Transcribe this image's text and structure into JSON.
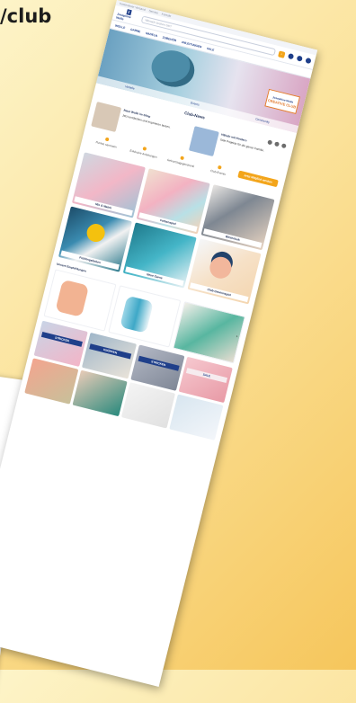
{
  "url_fragment": "/club",
  "page": {
    "topbar": [
      "Kostenloser Versand",
      "Service",
      "Kontakt"
    ],
    "logo": {
      "mark": "J",
      "name": "Josephine Wolle"
    },
    "search_placeholder": "Wonach suchen Sie?",
    "nav": [
      "WOLLE",
      "GARNE",
      "NADELN",
      "ZUBEHÖR",
      "ANLEITUNGEN",
      "SALE"
    ],
    "hero": {
      "badge_line1": "Josephine Wolle",
      "badge_line2": "CREATIVE CLUB",
      "tabs": [
        "Vorteile",
        "Events",
        "Community"
      ]
    },
    "section_title": "Club-News",
    "news": [
      {
        "title": "Neue Wolle im Shop",
        "text": "Jetzt entdecken und inspirieren lassen."
      },
      {
        "title": "Häkeln mit Kindern",
        "text": "Tolle Projekte für die ganze Familie."
      }
    ],
    "benefits": [
      "Punkte sammeln",
      "Exklusive Anleitungen",
      "Geburtstagsgeschenk",
      "Club-Events"
    ],
    "cta": "Jetzt Mitglied werden",
    "tiles": [
      {
        "caption": "Mix & Match"
      },
      {
        "caption": "Farbenspiel"
      },
      {
        "caption": "Winterlook"
      },
      {
        "caption": "Frühlingsfarben"
      },
      {
        "caption": "Neue Garne"
      },
      {
        "caption": "Club-Gewinnspiel"
      }
    ],
    "products_title": "Unsere Empfehlungen",
    "small_tiles": [
      "STRICKEN",
      "KNÜPFEN",
      "STRICKEN",
      "SALE",
      "",
      "",
      "",
      ""
    ]
  }
}
